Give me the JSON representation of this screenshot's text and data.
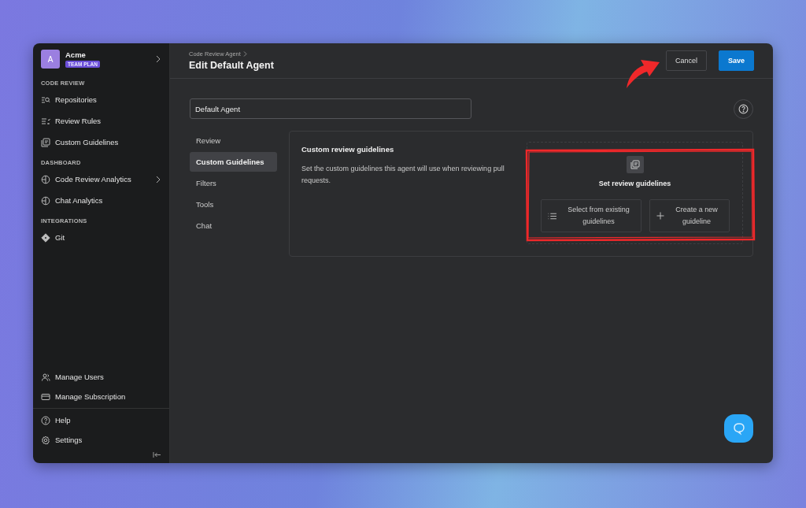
{
  "sidebar": {
    "workspace": {
      "initial": "A",
      "name": "Acme",
      "plan": "TEAM PLAN"
    },
    "sections": [
      {
        "heading": "CODE REVIEW",
        "items": [
          {
            "label": "Repositories",
            "kind": "repo",
            "has_submenu": false
          },
          {
            "label": "Review Rules",
            "kind": "rules",
            "has_submenu": false
          },
          {
            "label": "Custom Guidelines",
            "kind": "guidelines",
            "has_submenu": false
          }
        ]
      },
      {
        "heading": "DASHBOARD",
        "items": [
          {
            "label": "Code Review Analytics",
            "kind": "analytics",
            "has_submenu": true
          },
          {
            "label": "Chat Analytics",
            "kind": "analytics",
            "has_submenu": false
          }
        ]
      },
      {
        "heading": "INTEGRATIONS",
        "items": [
          {
            "label": "Git",
            "kind": "git",
            "has_submenu": false
          }
        ]
      }
    ],
    "footer_items": [
      {
        "label": "Manage Users",
        "kind": "users"
      },
      {
        "label": "Manage Subscription",
        "kind": "card"
      }
    ],
    "bottom_items": [
      {
        "label": "Help",
        "kind": "help"
      },
      {
        "label": "Settings",
        "kind": "settings"
      }
    ]
  },
  "header": {
    "breadcrumb": "Code Review Agent",
    "title": "Edit Default Agent",
    "buttons": [
      {
        "label": "Cancel",
        "kind": "secondary"
      },
      {
        "label": "Save",
        "kind": "primary"
      }
    ]
  },
  "name_field": {
    "value": "Default Agent"
  },
  "tabs": [
    {
      "label": "Review",
      "selected": false
    },
    {
      "label": "Custom Guidelines",
      "selected": true
    },
    {
      "label": "Filters",
      "selected": false
    },
    {
      "label": "Tools",
      "selected": false
    },
    {
      "label": "Chat",
      "selected": false
    }
  ],
  "panel": {
    "title": "Custom review guidelines",
    "description": "Set the custom guidelines this agent will use when reviewing pull requests.",
    "empty_state": {
      "title": "Set review guidelines",
      "options": [
        {
          "label": "Select from existing guidelines",
          "kind": "list"
        },
        {
          "label": "Create a new guideline",
          "kind": "plus"
        }
      ]
    }
  }
}
